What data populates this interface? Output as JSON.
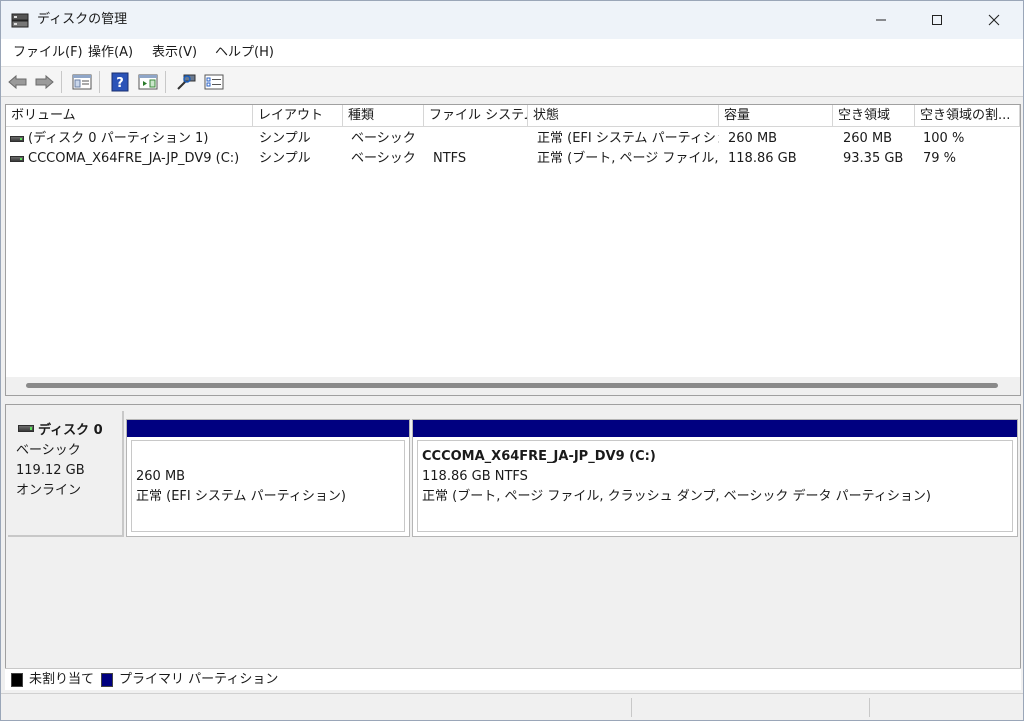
{
  "window": {
    "title": "ディスクの管理",
    "minimize": "—",
    "maximize": "☐",
    "close": "✕"
  },
  "menu": [
    {
      "label": "ファイル(F)"
    },
    {
      "label": "操作(A)"
    },
    {
      "label": "表示(V)"
    },
    {
      "label": "ヘルプ(H)"
    }
  ],
  "toolbar": {
    "icons": [
      "back-arrow-icon",
      "forward-arrow-icon",
      "console-tree-icon",
      "help-icon",
      "show-action-pane-icon",
      "rescan-disks-icon",
      "properties-icon"
    ]
  },
  "volume_list": {
    "columns": [
      "ボリューム",
      "レイアウト",
      "種類",
      "ファイル システム",
      "状態",
      "容量",
      "空き領域",
      "空き領域の割..."
    ],
    "rows": [
      {
        "volume": "(ディスク 0 パーティション 1)",
        "layout": "シンプル",
        "type": "ベーシック",
        "filesystem": "",
        "status": "正常 (EFI システム パーティショ...",
        "capacity": "260 MB",
        "free": "260 MB",
        "free_pct": "100 %"
      },
      {
        "volume": "CCCOMA_X64FRE_JA-JP_DV9 (C:)",
        "layout": "シンプル",
        "type": "ベーシック",
        "filesystem": "NTFS",
        "status": "正常 (ブート, ページ ファイル, ク...",
        "capacity": "118.86 GB",
        "free": "93.35 GB",
        "free_pct": "79 %"
      }
    ]
  },
  "disk": {
    "name": "ディスク 0",
    "type": "ベーシック",
    "size": "119.12 GB",
    "state": "オンライン",
    "partitions": [
      {
        "title": "",
        "size": "260 MB",
        "status": "正常 (EFI システム パーティション)"
      },
      {
        "title": "CCCOMA_X64FRE_JA-JP_DV9  (C:)",
        "size": "118.86 GB NTFS",
        "status": "正常 (ブート, ページ ファイル, クラッシュ ダンプ, ベーシック データ パーティション)"
      }
    ]
  },
  "legend": {
    "unallocated": "未割り当て",
    "primary": "プライマリ パーティション",
    "colors": {
      "unallocated": "#000000",
      "primary": "#000080"
    }
  }
}
